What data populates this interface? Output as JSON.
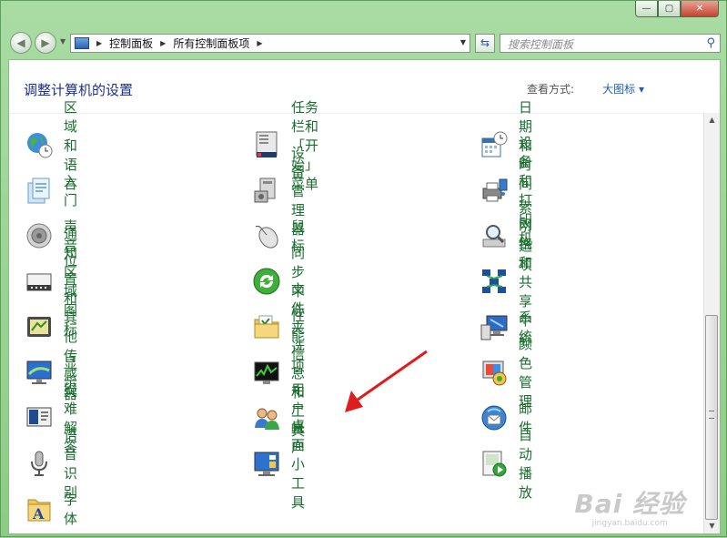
{
  "window": {
    "minimize_label": "—",
    "maximize_label": "▢",
    "close_label": "✕"
  },
  "nav": {
    "back_glyph": "◀",
    "forward_glyph": "▶",
    "dropdown_glyph": "▼",
    "breadcrumb": [
      "控制面板",
      "所有控制面板项"
    ],
    "search_placeholder": "搜索控制面板",
    "refresh_glyph": "⇆",
    "search_icon_glyph": "⚲"
  },
  "header": {
    "title": "调整计算机的设置",
    "viewby_label": "查看方式:",
    "viewby_value": "大图标 ▾"
  },
  "items": [
    {
      "label": "区域和语言",
      "icon": "globe-clock-icon"
    },
    {
      "label": "任务栏和「开始」菜单",
      "icon": "taskbar-icon"
    },
    {
      "label": "日期和时间",
      "icon": "calendar-clock-icon"
    },
    {
      "label": "入门",
      "icon": "getting-started-icon"
    },
    {
      "label": "设备管理器",
      "icon": "device-manager-icon"
    },
    {
      "label": "设备和打印机",
      "icon": "printer-icon"
    },
    {
      "label": "声音",
      "icon": "speaker-icon"
    },
    {
      "label": "鼠标",
      "icon": "mouse-icon"
    },
    {
      "label": "索引选项",
      "icon": "index-magnifier-icon"
    },
    {
      "label": "通知区域图标",
      "icon": "notification-area-icon"
    },
    {
      "label": "同步中心",
      "icon": "sync-center-icon"
    },
    {
      "label": "网络和共享中心",
      "icon": "network-icon"
    },
    {
      "label": "位置和其他传感器",
      "icon": "sensor-icon"
    },
    {
      "label": "文件夹选项",
      "icon": "folder-options-icon"
    },
    {
      "label": "系统",
      "icon": "system-icon"
    },
    {
      "label": "显示",
      "icon": "display-icon"
    },
    {
      "label": "性能信息和工具",
      "icon": "performance-icon"
    },
    {
      "label": "颜色管理",
      "icon": "color-management-icon"
    },
    {
      "label": "疑难解答",
      "icon": "troubleshoot-icon"
    },
    {
      "label": "用户帐户",
      "icon": "user-accounts-icon"
    },
    {
      "label": "邮件",
      "icon": "mail-icon"
    },
    {
      "label": "语音识别",
      "icon": "microphone-icon"
    },
    {
      "label": "桌面小工具",
      "icon": "gadgets-icon"
    },
    {
      "label": "自动播放",
      "icon": "autoplay-icon"
    },
    {
      "label": "字体",
      "icon": "fonts-icon"
    }
  ],
  "scrollbar": {
    "up_glyph": "▲",
    "down_glyph": "▼"
  },
  "watermark": {
    "logo": "Bai 经验",
    "sub": "jingyan.baidu.com"
  },
  "colors": {
    "item_text": "#1a6e2e",
    "title_text": "#1e3287",
    "annotation_arrow": "#e01c1c"
  }
}
